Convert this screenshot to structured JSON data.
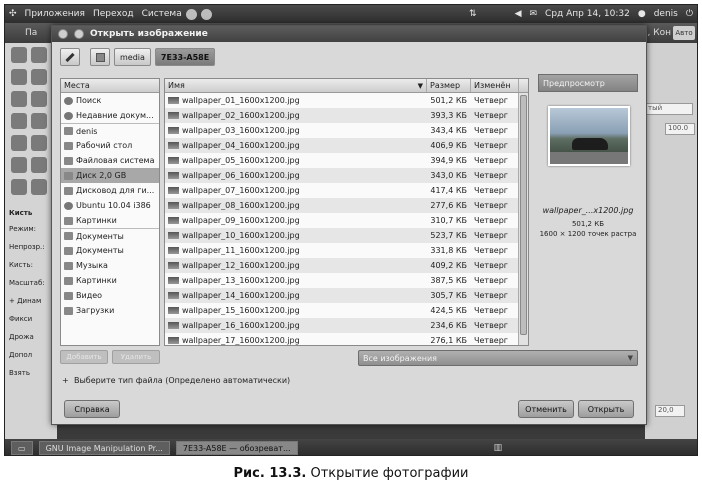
{
  "top_panel": {
    "menus": [
      "Приложения",
      "Переход",
      "Система"
    ],
    "clock": "Срд Апр 14, 10:32",
    "user": "denis"
  },
  "gimp_bg": {
    "title_left": "Па",
    "title_right": "налы, Кон",
    "auto_label": "Авто",
    "toolbox_labels": [
      "Кисть",
      "Режим:",
      "Непрозр.:",
      "Кисть:",
      "Масштаб:",
      "+ Динам",
      "Фикси",
      "Дрожа",
      "Допол",
      "Взять"
    ],
    "dock_value_1": "100.0",
    "dock_value_2": "20,0",
    "dock_label_chisto": "тый"
  },
  "dialog": {
    "title": "Открыть изображение",
    "path_buttons": [
      "media",
      "7E33-A58E"
    ],
    "places_header": "Места",
    "places": [
      {
        "label": "Поиск",
        "icon": "search-icon"
      },
      {
        "label": "Недавние докум...",
        "icon": "recent-icon"
      },
      {
        "label": "denis",
        "icon": "home-folder-icon"
      },
      {
        "label": "Рабочий стол",
        "icon": "desktop-icon"
      },
      {
        "label": "Файловая система",
        "icon": "filesystem-icon"
      },
      {
        "label": "Диск 2,0 GB",
        "icon": "drive-icon"
      },
      {
        "label": "Дисковод для ги...",
        "icon": "floppy-icon"
      },
      {
        "label": "Ubuntu 10.04 i386",
        "icon": "cdrom-icon"
      },
      {
        "label": "Картинки",
        "icon": "folder-icon"
      },
      {
        "label": "Документы",
        "icon": "folder-icon"
      },
      {
        "label": "Документы",
        "icon": "folder-icon"
      },
      {
        "label": "Музыка",
        "icon": "music-icon"
      },
      {
        "label": "Картинки",
        "icon": "folder-icon"
      },
      {
        "label": "Видео",
        "icon": "video-icon"
      },
      {
        "label": "Загрузки",
        "icon": "folder-icon"
      }
    ],
    "add_button": "Добавить",
    "remove_button": "Удалить",
    "files_columns": {
      "name": "Имя",
      "size": "Размер",
      "modified": "Изменён"
    },
    "files": [
      {
        "name": "wallpaper_01_1600x1200.jpg",
        "size": "501,2 КБ",
        "modified": "Четверг"
      },
      {
        "name": "wallpaper_02_1600x1200.jpg",
        "size": "393,3 КБ",
        "modified": "Четверг"
      },
      {
        "name": "wallpaper_03_1600x1200.jpg",
        "size": "343,4 КБ",
        "modified": "Четверг"
      },
      {
        "name": "wallpaper_04_1600x1200.jpg",
        "size": "406,9 КБ",
        "modified": "Четверг"
      },
      {
        "name": "wallpaper_05_1600x1200.jpg",
        "size": "394,9 КБ",
        "modified": "Четверг"
      },
      {
        "name": "wallpaper_06_1600x1200.jpg",
        "size": "343,0 КБ",
        "modified": "Четверг"
      },
      {
        "name": "wallpaper_07_1600x1200.jpg",
        "size": "417,4 КБ",
        "modified": "Четверг"
      },
      {
        "name": "wallpaper_08_1600x1200.jpg",
        "size": "277,6 КБ",
        "modified": "Четверг"
      },
      {
        "name": "wallpaper_09_1600x1200.jpg",
        "size": "310,7 КБ",
        "modified": "Четверг"
      },
      {
        "name": "wallpaper_10_1600x1200.jpg",
        "size": "523,7 КБ",
        "modified": "Четверг"
      },
      {
        "name": "wallpaper_11_1600x1200.jpg",
        "size": "331,8 КБ",
        "modified": "Четверг"
      },
      {
        "name": "wallpaper_12_1600x1200.jpg",
        "size": "409,2 КБ",
        "modified": "Четверг"
      },
      {
        "name": "wallpaper_13_1600x1200.jpg",
        "size": "387,5 КБ",
        "modified": "Четверг"
      },
      {
        "name": "wallpaper_14_1600x1200.jpg",
        "size": "305,7 КБ",
        "modified": "Четверг"
      },
      {
        "name": "wallpaper_15_1600x1200.jpg",
        "size": "424,5 КБ",
        "modified": "Четверг"
      },
      {
        "name": "wallpaper_16_1600x1200.jpg",
        "size": "234,6 КБ",
        "modified": "Четверг"
      },
      {
        "name": "wallpaper_17_1600x1200.jpg",
        "size": "276,1 КБ",
        "modified": "Четверг"
      }
    ],
    "preview": {
      "title": "Предпросмотр",
      "name": "wallpaper_...x1200.jpg",
      "size": "501,2 КБ",
      "dims": "1600 × 1200 точек растра"
    },
    "filter": "Все изображения",
    "filetype_label": "Выберите тип файла (Определено автоматически)",
    "help_button": "Справка",
    "cancel_button": "Отменить",
    "open_button": "Открыть"
  },
  "taskbar": {
    "items": [
      "GNU Image Manipulation Pr...",
      "7E33-A58E — обозреват..."
    ]
  },
  "caption": {
    "number": "Рис. 13.3.",
    "text": "Открытие фотографии"
  }
}
